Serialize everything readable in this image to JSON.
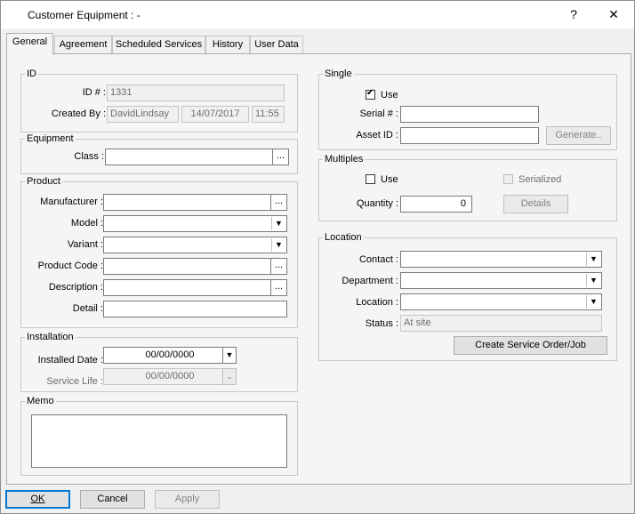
{
  "window": {
    "title": "Customer Equipment :  -",
    "help_glyph": "?",
    "close_glyph": "✕"
  },
  "tabs": [
    {
      "label": "General"
    },
    {
      "label": "Agreement"
    },
    {
      "label": "Scheduled Services"
    },
    {
      "label": "History"
    },
    {
      "label": "User Data"
    }
  ],
  "id_group": {
    "title": "ID",
    "id_label": "ID # :",
    "id_value": "1331",
    "created_label": "Created By :",
    "created_by": "DavidLindsay",
    "created_date": "14/07/2017",
    "created_time": "11:55"
  },
  "equipment_group": {
    "title": "Equipment",
    "class_label": "Class :",
    "class_value": "",
    "ellipsis": "..."
  },
  "product_group": {
    "title": "Product",
    "manufacturer_label": "Manufacturer :",
    "model_label": "Model :",
    "variant_label": "Variant :",
    "product_code_label": "Product Code :",
    "description_label": "Description :",
    "detail_label": "Detail :",
    "manufacturer_value": "",
    "model_value": "",
    "variant_value": "",
    "product_code_value": "",
    "description_value": "",
    "detail_value": ""
  },
  "installation_group": {
    "title": "Installation",
    "installed_label": "Installed Date :",
    "installed_value": "00/00/0000",
    "service_label": "Service Life :",
    "service_value": "00/00/0000"
  },
  "memo_group": {
    "title": "Memo",
    "value": ""
  },
  "single_group": {
    "title": "Single",
    "use_label": "Use",
    "use_checked": true,
    "serial_label": "Serial # :",
    "serial_value": "",
    "asset_label": "Asset ID :",
    "asset_value": "",
    "generate_label": "Generate.."
  },
  "multiples_group": {
    "title": "Multiples",
    "use_label": "Use",
    "serialized_label": "Serialized",
    "quantity_label": "Quantity :",
    "quantity_value": "0",
    "details_label": "Details"
  },
  "location_group": {
    "title": "Location",
    "contact_label": "Contact :",
    "department_label": "Department :",
    "location_label": "Location :",
    "status_label": "Status :",
    "status_value": "At site",
    "contact_value": "",
    "department_value": "",
    "location_value": "",
    "create_order_label": "Create Service Order/Job"
  },
  "footer": {
    "ok_label": "OK",
    "cancel_label": "Cancel",
    "apply_label": "Apply"
  },
  "icons": {
    "dropdown": "chevron-down-icon",
    "check": "check-icon"
  }
}
